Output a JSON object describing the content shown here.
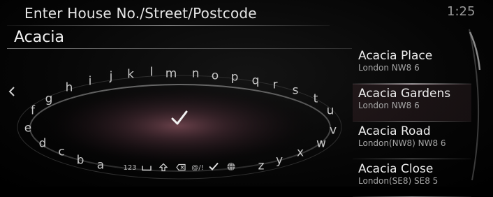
{
  "header": {
    "title": "Enter House No./Street/Postcode",
    "clock": "1:25"
  },
  "input": {
    "value": "Acacia"
  },
  "keyboard": {
    "letters": [
      "a",
      "b",
      "c",
      "d",
      "e",
      "f",
      "g",
      "h",
      "i",
      "j",
      "k",
      "l",
      "m",
      "n",
      "o",
      "p",
      "q",
      "r",
      "s",
      "t",
      "u",
      "v",
      "w",
      "x",
      "y",
      "z"
    ],
    "function_keys": {
      "numbers": "123",
      "symbols": "@/!"
    },
    "icons": [
      "back-arrow-icon",
      "check-icon",
      "space-icon",
      "shift-icon",
      "backspace-icon",
      "globe-icon"
    ]
  },
  "results": [
    {
      "name": "Acacia Place",
      "detail": "London NW8 6",
      "selected": false
    },
    {
      "name": "Acacia Gardens",
      "detail": "London NW8 6",
      "selected": true
    },
    {
      "name": "Acacia Road",
      "detail": "London(NW8) NW8 6",
      "selected": false
    },
    {
      "name": "Acacia Close",
      "detail": "London(SE8) SE8 5",
      "selected": false
    }
  ],
  "colors": {
    "background": "#000000",
    "text": "#e6e6e6",
    "subtext": "#a6a6a6",
    "glow": "#7a4a55"
  }
}
